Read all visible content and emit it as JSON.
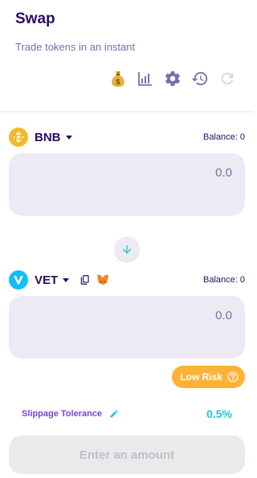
{
  "header": {
    "title": "Swap",
    "subtitle": "Trade tokens in an instant",
    "tools": [
      "money-bag-icon",
      "chart-icon",
      "settings-icon",
      "history-icon",
      "refresh-icon"
    ]
  },
  "input": {
    "token_symbol": "BNB",
    "balance": "Balance: 0",
    "placeholder": "0.0",
    "logo_color": "#f3ba2f"
  },
  "output": {
    "token_symbol": "VET",
    "balance": "Balance: 0",
    "placeholder": "0.0",
    "logo_color": "#15bdff"
  },
  "risk": {
    "label": "Low Risk",
    "color": "#ffb237"
  },
  "slippage": {
    "label": "Slippage Tolerance",
    "value": "0.5%"
  },
  "cta": {
    "label": "Enter an amount"
  },
  "colors": {
    "primary_text": "#280d5f",
    "secondary_text": "#7a6eaa",
    "accent": "#1fc7d4",
    "purple": "#7645d9",
    "input_bg": "#eeeaf4"
  }
}
